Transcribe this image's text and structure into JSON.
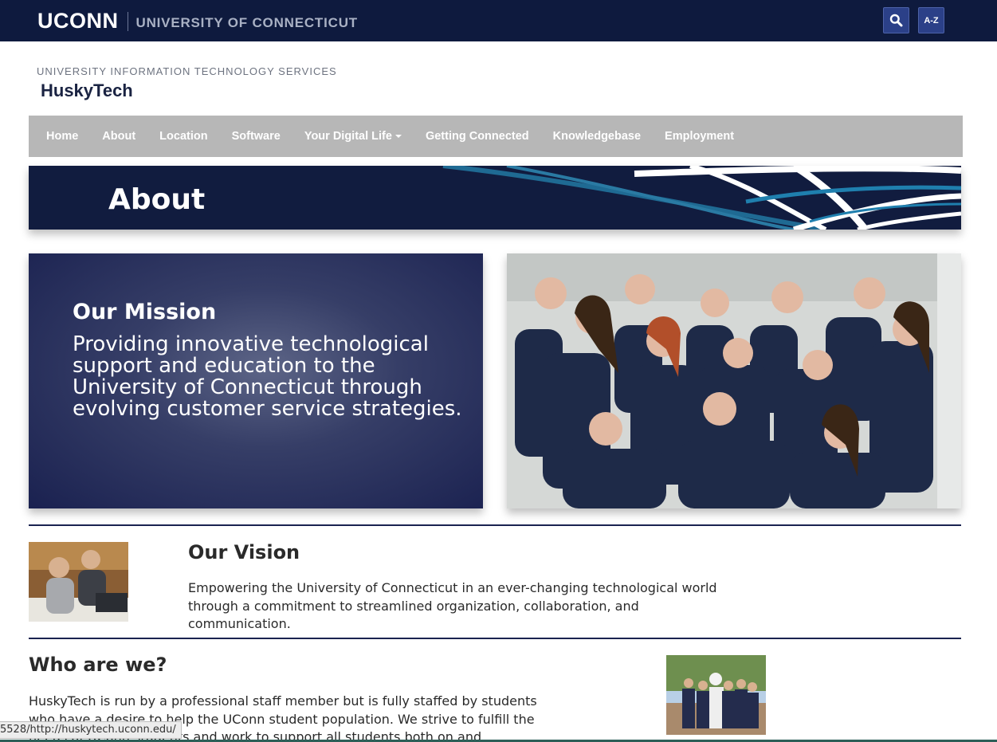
{
  "topbar": {
    "logo": "UCONN",
    "university": "UNIVERSITY OF CONNECTICUT",
    "search_icon": "search-icon",
    "az_label": "A-Z",
    "bg_color": "#0e1a3e",
    "button_color": "#2b4088"
  },
  "header": {
    "department": "UNIVERSITY INFORMATION TECHNOLOGY SERVICES",
    "site_title": "HuskyTech"
  },
  "nav": {
    "items": [
      {
        "label": "Home"
      },
      {
        "label": "About"
      },
      {
        "label": "Location"
      },
      {
        "label": "Software"
      },
      {
        "label": "Your Digital Life",
        "dropdown": true
      },
      {
        "label": "Getting Connected"
      },
      {
        "label": "Knowledgebase"
      },
      {
        "label": "Employment"
      }
    ],
    "bg_color": "#b7b7b7"
  },
  "banner": {
    "title": "About",
    "bg_color": "#111c3f"
  },
  "mission": {
    "heading": "Our Mission",
    "text": "Providing innovative technological support and education to the University of Connecticut through evolving customer service strategies."
  },
  "vision": {
    "heading": "Our Vision",
    "text": "Empowering the University of Connecticut in an ever-changing technological world through a commitment to streamlined organization, collaboration, and communication."
  },
  "who": {
    "heading": "Who are we?",
    "text": "HuskyTech is run by a professional staff member but is fully staffed by students who have a desire to help the UConn student population. We strive to fulfill the needs of UConn students and work to support all students both on and"
  },
  "status_bar": {
    "url": "5528/http://huskytech.uconn.edu/"
  }
}
